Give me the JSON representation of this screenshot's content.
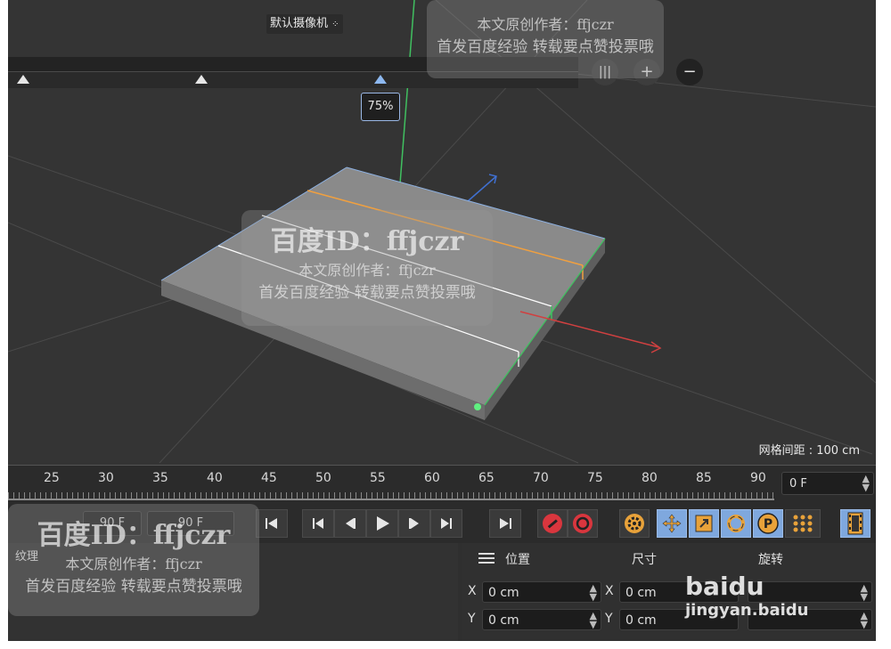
{
  "viewport": {
    "camera_label": "默认摄像机",
    "zoom_percent": "75%",
    "plus_label": "+",
    "minus_label": "−",
    "grid_spacing": "网格间距 : 100 cm"
  },
  "timeline": {
    "ruler_numbers": [
      "25",
      "30",
      "35",
      "40",
      "45",
      "50",
      "55",
      "60",
      "65",
      "70",
      "75",
      "80",
      "85",
      "90"
    ],
    "current_frame": "0 F",
    "start_field": "90 F",
    "end_field": "90 F"
  },
  "attributes": {
    "left_tab": "纹理",
    "headers": {
      "position": "位置",
      "size": "尺寸",
      "rotation": "旋转"
    },
    "rows": [
      {
        "axis_pos": "X",
        "pos": "0 cm",
        "axis_size": "X",
        "size": "0 cm"
      },
      {
        "axis_pos": "Y",
        "pos": "0 cm",
        "axis_size": "Y",
        "size": "0 cm"
      }
    ]
  },
  "watermarks": {
    "brand": "百度ID：ffjczr",
    "author": "本文原创作者：ffjczr",
    "slogan": "首发百度经验 转载要点赞投票哦",
    "baidu": "baidu",
    "jingyan": "jingyan.baidu"
  },
  "colors": {
    "accent_blue": "#7fa8de",
    "record_red": "#d9363e",
    "key_orange": "#e8a23a",
    "axis_x": "#d04040",
    "axis_y": "#40c060",
    "axis_z": "#4070d0"
  }
}
